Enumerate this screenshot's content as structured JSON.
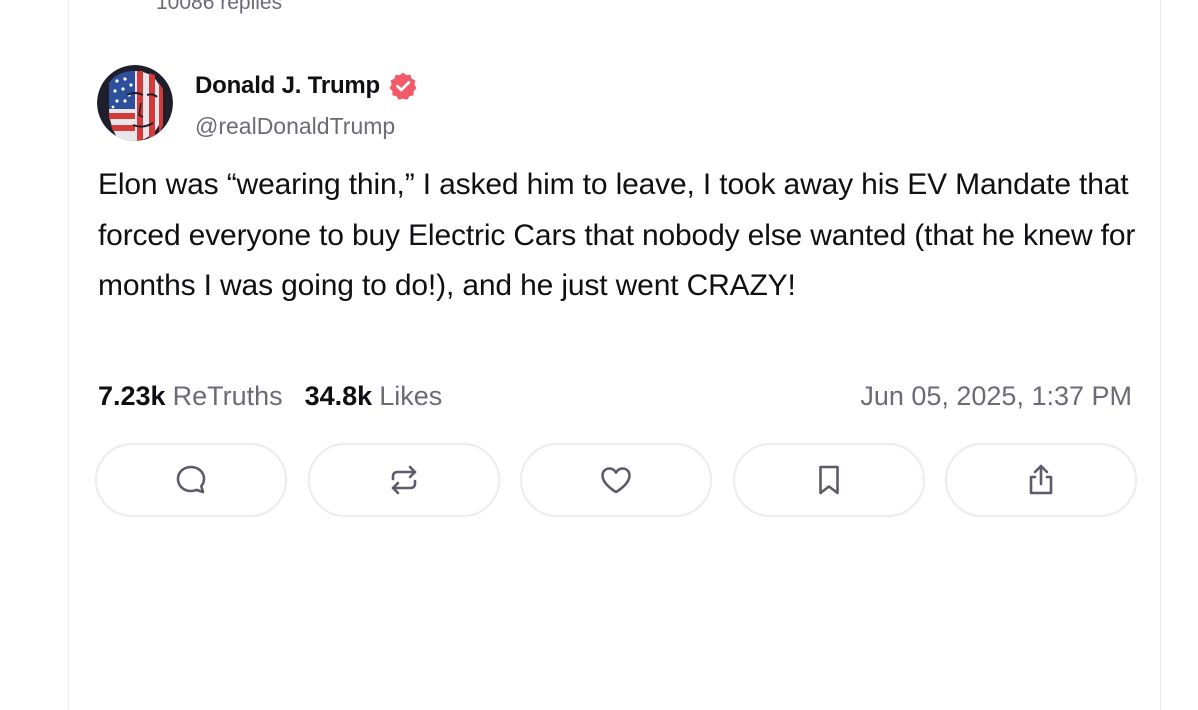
{
  "thread": {
    "replies_count": "10086 replies"
  },
  "post": {
    "author": {
      "name": "Donald J. Trump",
      "handle": "@realDonaldTrump",
      "verified": true,
      "verified_badge_color": "#f25a6a",
      "avatar_icon": "flag-face-avatar"
    },
    "body": "Elon was “wearing thin,” I asked him to leave, I took away his EV Mandate that forced everyone to buy Electric Cars that nobody else wanted (that he knew for months I was going to do!), and he just went CRAZY!",
    "stats": {
      "retruths_count": "7.23k",
      "retruths_label": "ReTruths",
      "likes_count": "34.8k",
      "likes_label": "Likes"
    },
    "timestamp": "Jun 05, 2025, 1:37 PM"
  },
  "actions": [
    {
      "name": "reply",
      "icon": "reply-icon"
    },
    {
      "name": "retruth",
      "icon": "retruth-icon"
    },
    {
      "name": "like",
      "icon": "heart-icon"
    },
    {
      "name": "bookmark",
      "icon": "bookmark-icon"
    },
    {
      "name": "share",
      "icon": "share-icon"
    }
  ],
  "colors": {
    "text_primary": "#0f0f14",
    "text_secondary": "#6b6b78",
    "border": "#ececf0",
    "icon": "#5b5b6b"
  }
}
